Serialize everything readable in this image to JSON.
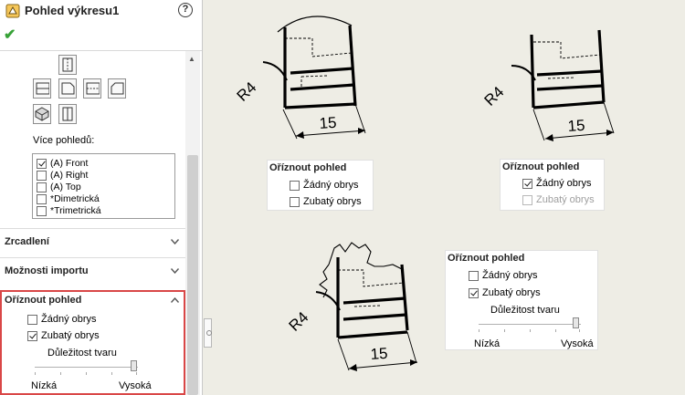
{
  "panel": {
    "title": "Pohled výkresu1",
    "help_glyph": "?",
    "ok_glyph": "✔",
    "more_views_label": "Více pohledů:",
    "views_list": [
      {
        "label": "(A) Front",
        "checked": true
      },
      {
        "label": "(A) Right",
        "checked": false
      },
      {
        "label": "(A) Top",
        "checked": false
      },
      {
        "label": "*Dimetrická",
        "checked": false
      },
      {
        "label": "*Trimetrická",
        "checked": false
      }
    ],
    "sections": {
      "mirror": "Zrcadlení",
      "import_options": "Možnosti importu",
      "crop_view": "Oříznout pohled"
    },
    "crop": {
      "none_outline": "Žádný obrys",
      "jagged_outline": "Zubatý obrys",
      "shape_intensity": "Důležitost tvaru",
      "low": "Nízká",
      "high": "Vysoká"
    },
    "colors": {
      "accent_red": "#d94747",
      "ok_green": "#38a238"
    }
  },
  "canvas": {
    "views": [
      {
        "radius_label": "R4",
        "dim_label": "15"
      },
      {
        "radius_label": "R4",
        "dim_label": "15"
      },
      {
        "radius_label": "R4",
        "dim_label": "15"
      }
    ],
    "mini_panels": [
      {
        "title": "Oříznout pohled",
        "opt1": "Žádný obrys",
        "opt2": "Zubatý obrys"
      },
      {
        "title": "Oříznout pohled",
        "opt1": "Žádný obrys",
        "opt2": "Zubatý obrys"
      },
      {
        "title": "Oříznout pohled",
        "opt1": "Žádný obrys",
        "opt2": "Zubatý obrys",
        "intensity": "Důležitost tvaru",
        "low": "Nízká",
        "high": "Vysoká"
      }
    ]
  }
}
